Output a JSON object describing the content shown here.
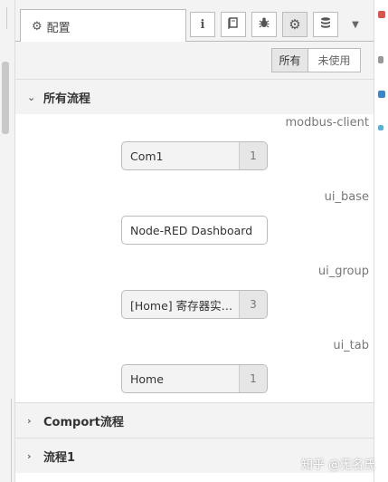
{
  "tabs": {
    "active_label": "配置",
    "icons": [
      "info-icon",
      "book-icon",
      "bug-icon",
      "gear-icon",
      "database-icon"
    ]
  },
  "filter": {
    "all_label": "所有",
    "unused_label": "未使用"
  },
  "sections": [
    {
      "title": "所有流程",
      "expanded": true,
      "groups": [
        {
          "type": "modbus-client",
          "node": "Com1",
          "count": "1"
        },
        {
          "type": "ui_base",
          "node": "Node-RED Dashboard",
          "count": ""
        },
        {
          "type": "ui_group",
          "node": "[Home] 寄存器实…",
          "count": "3"
        },
        {
          "type": "ui_tab",
          "node": "Home",
          "count": "1"
        }
      ]
    },
    {
      "title": "Comport流程",
      "expanded": false
    },
    {
      "title": "流程1",
      "expanded": false
    }
  ],
  "watermark": "知乎 @无名氏",
  "colors": {
    "panel_bg": "#f3f3f3",
    "border": "#bbbbbb",
    "accent_red": "#d9534f",
    "accent_blue": "#3a86c8"
  }
}
